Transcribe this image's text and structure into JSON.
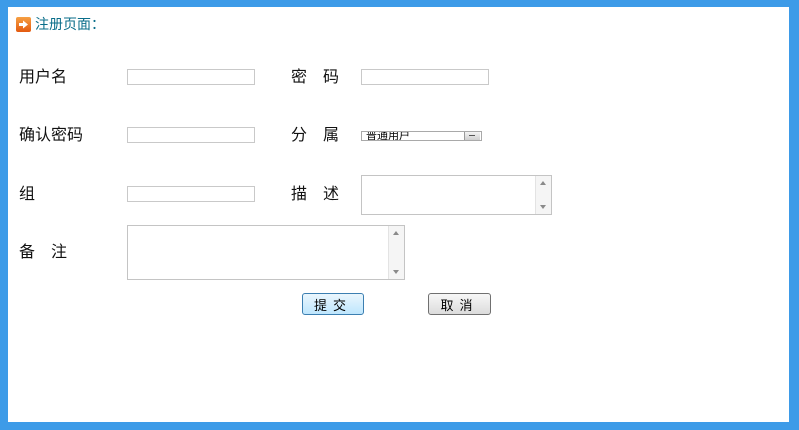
{
  "header": {
    "title": "注册页面："
  },
  "form": {
    "username_label": "用户名",
    "password_label": "密　码",
    "confirm_label": "确认密码",
    "division_label": "分　属",
    "division_selected": "普通用户",
    "group_label": "组",
    "description_label": "描　述",
    "remarks_label": "备　注"
  },
  "buttons": {
    "submit": "提交",
    "cancel": "取消"
  },
  "colors": {
    "border": "#3d9be8",
    "title": "#0a6e8a"
  }
}
